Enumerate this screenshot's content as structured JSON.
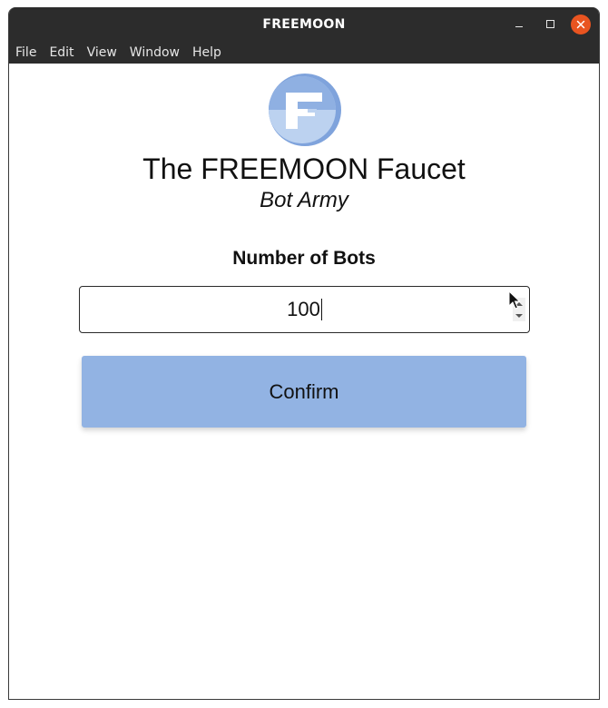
{
  "window": {
    "title": "FREEMOON",
    "controls": {
      "minimize_icon": "minimize-icon",
      "maximize_icon": "maximize-icon",
      "close_icon": "close-icon",
      "close_color": "#e95420"
    }
  },
  "menubar": {
    "items": [
      {
        "label": "File"
      },
      {
        "label": "Edit"
      },
      {
        "label": "View"
      },
      {
        "label": "Window"
      },
      {
        "label": "Help"
      }
    ]
  },
  "page": {
    "heading": "The FREEMOON Faucet",
    "subheading": "Bot Army",
    "field_label": "Number of Bots",
    "bots_value": "100",
    "confirm_label": "Confirm"
  },
  "colors": {
    "button_bg": "#92b3e3",
    "logo_light": "#bcd2f0",
    "logo_dark": "#7fa3dc",
    "titlebar": "#2c2c2c"
  }
}
